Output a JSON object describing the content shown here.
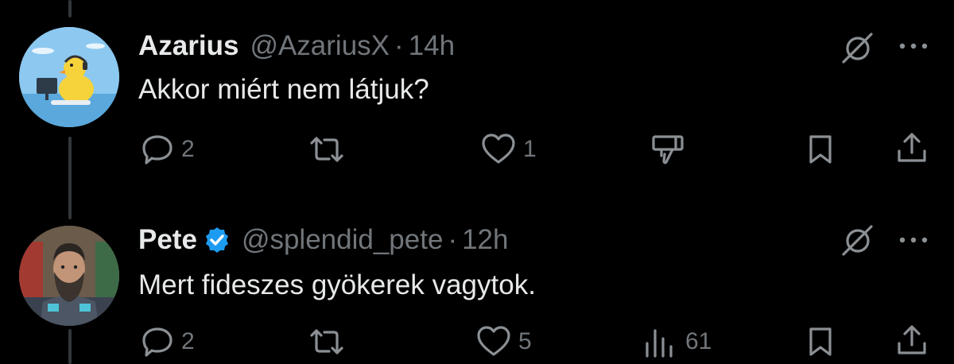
{
  "tweets": [
    {
      "name": "Azarius",
      "handle": "@AzariusX",
      "separator": "·",
      "time": "14h",
      "text": "Akkor miért nem látjuk?",
      "verified": false,
      "actions": {
        "reply_count": "2",
        "retweet_count": "",
        "like_count": "1",
        "views_count": ""
      },
      "third_action_icon": "dislike-icon"
    },
    {
      "name": "Pete",
      "handle": "@splendid_pete",
      "separator": "·",
      "time": "12h",
      "text": "Mert fideszes gyökerek vagytok.",
      "verified": true,
      "actions": {
        "reply_count": "2",
        "retweet_count": "",
        "like_count": "5",
        "views_count": "61"
      },
      "third_action_icon": "views-icon"
    }
  ],
  "colors": {
    "background": "#000000",
    "primary_text": "#e7e9ea",
    "secondary_text": "#71767b",
    "verified_badge": "#1d9bf0",
    "thread_line": "#333639"
  }
}
